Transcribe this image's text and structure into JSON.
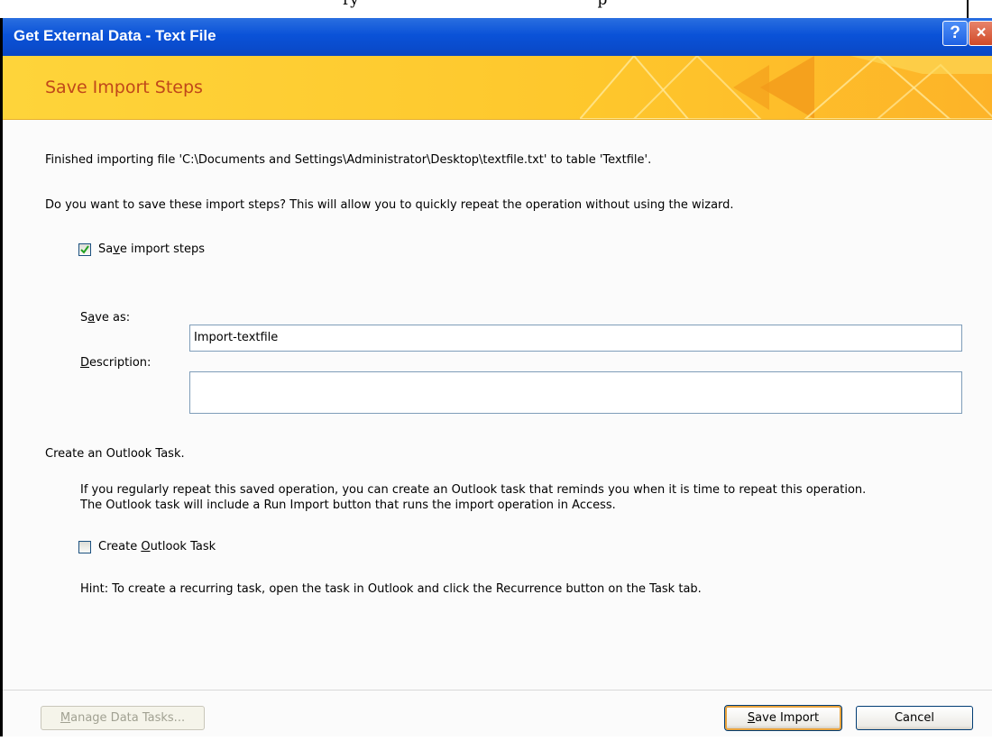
{
  "background": {
    "fragment": "ry ·                                               p"
  },
  "window": {
    "title": "Get External Data - Text File",
    "help_label": "?",
    "close_label": "×"
  },
  "banner": {
    "title": "Save Import Steps"
  },
  "content": {
    "finished_text": "Finished importing file 'C:\\Documents and Settings\\Administrator\\Desktop\\textfile.txt' to table 'Textfile'.",
    "question_text": "Do you want to save these import steps? This will allow you to quickly repeat the operation without using the wizard.",
    "save_steps": {
      "label_pre": "Sa",
      "label_key": "v",
      "label_post": "e import steps",
      "checked": true
    },
    "save_as": {
      "label_pre": "S",
      "label_key": "a",
      "label_post": "ve as:",
      "value": "Import-textfile"
    },
    "description": {
      "label_key": "D",
      "label_post": "escription:",
      "value": ""
    },
    "outlook_heading": "Create an Outlook Task.",
    "outlook_info_1": "If you regularly repeat this saved operation, you can create an Outlook task that reminds you when it is time to repeat this operation.",
    "outlook_info_2": "The Outlook task will include a Run Import button that runs the import operation in Access.",
    "outlook_task": {
      "label_pre": "Create ",
      "label_key": "O",
      "label_post": "utlook Task",
      "checked": false
    },
    "hint": "Hint: To create a recurring task, open the task in Outlook and click the Recurrence button on the Task tab."
  },
  "footer": {
    "manage": {
      "label_key": "M",
      "label_post": "anage Data Tasks...",
      "enabled": false
    },
    "save_import": {
      "label_key": "S",
      "label_post": "ave Import"
    },
    "cancel": {
      "label": "Cancel"
    }
  },
  "colors": {
    "titlebar": "#0a52d8",
    "banner": "#fec72c",
    "banner_title": "#c0471a",
    "default_button_ring": "#e8a33d"
  }
}
